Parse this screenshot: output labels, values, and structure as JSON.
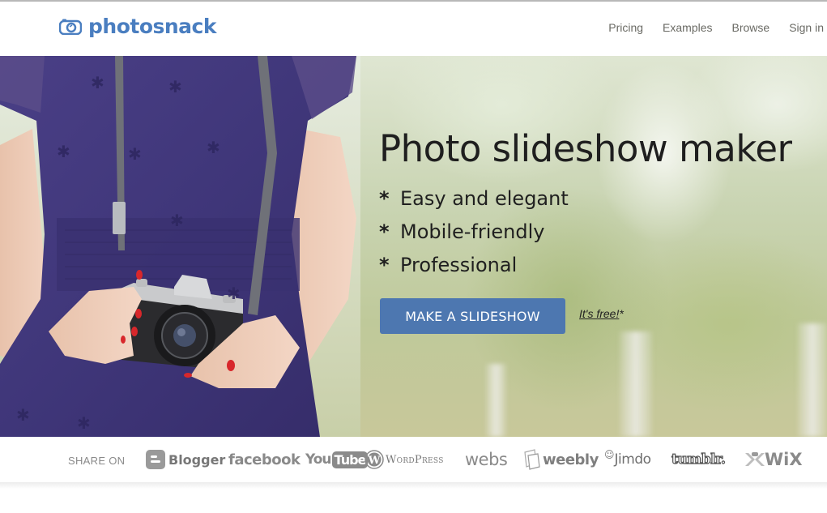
{
  "header": {
    "logo_text": "photosnack",
    "nav": [
      {
        "label": "Pricing"
      },
      {
        "label": "Examples"
      },
      {
        "label": "Browse"
      },
      {
        "label": "Sign in"
      }
    ]
  },
  "hero": {
    "title": "Photo slideshow maker",
    "bullet": "*",
    "features": [
      "Easy and elegant",
      "Mobile-friendly",
      "Professional"
    ],
    "cta_label": "MAKE A SLIDESHOW",
    "free_label": "It's free!",
    "free_suffix": "*",
    "image_description": "woman in purple dress holding a vintage camera"
  },
  "share": {
    "label": "SHARE ON",
    "platforms": [
      {
        "name": "Blogger",
        "icon": "blogger-logo"
      },
      {
        "name": "facebook",
        "icon": "facebook-logo"
      },
      {
        "name": "YouTube",
        "icon": "youtube-logo"
      },
      {
        "name": "WordPress",
        "icon": "wordpress-logo"
      },
      {
        "name": "webs",
        "icon": "webs-logo"
      },
      {
        "name": "weebly",
        "icon": "weebly-logo"
      },
      {
        "name": "Jimdo",
        "icon": "jimdo-logo"
      },
      {
        "name": "tumblr.",
        "icon": "tumblr-logo"
      },
      {
        "name": "WiX",
        "icon": "wix-logo"
      }
    ]
  },
  "colors": {
    "brand": "#4a7ec0",
    "cta": "#4d77b0",
    "nav_text": "#6a6a64",
    "dress": "#3e3575"
  }
}
